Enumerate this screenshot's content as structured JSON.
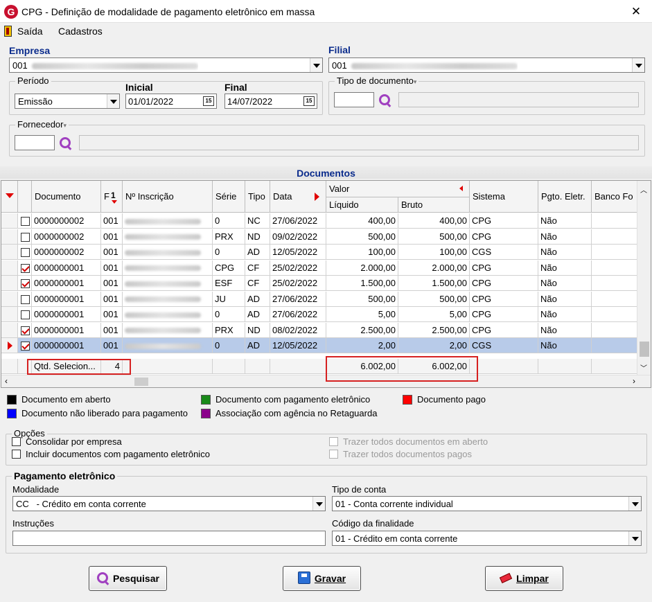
{
  "window": {
    "title": "CPG - Definição de modalidade de pagamento eletrônico em massa",
    "app_icon": "G",
    "close_symbol": "✕"
  },
  "menu": [
    {
      "label": "Saída"
    },
    {
      "label": "Cadastros"
    }
  ],
  "empresa": {
    "label": "Empresa",
    "value_prefix": "001"
  },
  "filial": {
    "label": "Filial",
    "value_prefix": "001"
  },
  "periodo": {
    "label": "Período",
    "value": "Emissão"
  },
  "inicial": {
    "label": "Inicial",
    "value": "01/01/2022"
  },
  "final": {
    "label": "Final",
    "value": "14/07/2022"
  },
  "calendar_icon_text": "15",
  "tipo_documento": {
    "label": "Tipo de documento"
  },
  "fornecedor": {
    "label": "Fornecedor"
  },
  "grid": {
    "title": "Documentos",
    "headers": {
      "documento": "Documento",
      "f": "F",
      "sort_num": "1",
      "inscricao": "Nº Inscrição",
      "serie": "Série",
      "tipo": "Tipo",
      "data": "Data",
      "valor": "Valor",
      "liquido": "Líquido",
      "bruto": "Bruto",
      "sistema": "Sistema",
      "pgto": "Pgto. Eletr.",
      "banco": "Banco Fo"
    },
    "rows": [
      {
        "checked": false,
        "documento": "0000000002",
        "f": "001",
        "serie": "0",
        "tipo": "NC",
        "data": "27/06/2022",
        "liquido": "400,00",
        "bruto": "400,00",
        "sistema": "CPG",
        "pgto": "Não",
        "selected": false
      },
      {
        "checked": false,
        "documento": "0000000002",
        "f": "001",
        "serie": "PRX",
        "tipo": "ND",
        "data": "09/02/2022",
        "liquido": "500,00",
        "bruto": "500,00",
        "sistema": "CPG",
        "pgto": "Não",
        "selected": false
      },
      {
        "checked": false,
        "documento": "0000000002",
        "f": "001",
        "serie": "0",
        "tipo": "AD",
        "data": "12/05/2022",
        "liquido": "100,00",
        "bruto": "100,00",
        "sistema": "CGS",
        "pgto": "Não",
        "selected": false
      },
      {
        "checked": true,
        "documento": "0000000001",
        "f": "001",
        "serie": "CPG",
        "tipo": "CF",
        "data": "25/02/2022",
        "liquido": "2.000,00",
        "bruto": "2.000,00",
        "sistema": "CPG",
        "pgto": "Não",
        "selected": false
      },
      {
        "checked": true,
        "documento": "0000000001",
        "f": "001",
        "serie": "ESF",
        "tipo": "CF",
        "data": "25/02/2022",
        "liquido": "1.500,00",
        "bruto": "1.500,00",
        "sistema": "CPG",
        "pgto": "Não",
        "selected": false
      },
      {
        "checked": false,
        "documento": "0000000001",
        "f": "001",
        "serie": "JU",
        "tipo": "AD",
        "data": "27/06/2022",
        "liquido": "500,00",
        "bruto": "500,00",
        "sistema": "CPG",
        "pgto": "Não",
        "selected": false
      },
      {
        "checked": false,
        "documento": "0000000001",
        "f": "001",
        "serie": "0",
        "tipo": "AD",
        "data": "27/06/2022",
        "liquido": "5,00",
        "bruto": "5,00",
        "sistema": "CPG",
        "pgto": "Não",
        "selected": false
      },
      {
        "checked": true,
        "documento": "0000000001",
        "f": "001",
        "serie": "PRX",
        "tipo": "ND",
        "data": "08/02/2022",
        "liquido": "2.500,00",
        "bruto": "2.500,00",
        "sistema": "CPG",
        "pgto": "Não",
        "selected": false
      },
      {
        "checked": true,
        "documento": "0000000001",
        "f": "001",
        "serie": "0",
        "tipo": "AD",
        "data": "12/05/2022",
        "liquido": "2,00",
        "bruto": "2,00",
        "sistema": "CGS",
        "pgto": "Não",
        "selected": true
      }
    ],
    "footer": {
      "qtd_label": "Qtd. Selecion...",
      "qtd_value": "4",
      "liquido_total": "6.002,00",
      "bruto_total": "6.002,00"
    }
  },
  "legend": [
    {
      "color": "#000000",
      "label": "Documento em aberto"
    },
    {
      "color": "#1a8a1a",
      "label": "Documento com pagamento eletrônico"
    },
    {
      "color": "#ff0000",
      "label": "Documento pago"
    },
    {
      "color": "#0000ff",
      "label": "Documento não liberado para pagamento"
    },
    {
      "color": "#8b008b",
      "label": "Associação com agência no Retaguarda"
    }
  ],
  "opcoes": {
    "title": "Opções",
    "consolidar": "Consolidar por empresa",
    "incluir": "Incluir documentos com pagamento eletrônico",
    "trazer_aberto": "Trazer todos documentos em aberto",
    "trazer_pagos": "Trazer todos documentos pagos"
  },
  "pagamento": {
    "title": "Pagamento eletrônico",
    "modalidade_label": "Modalidade",
    "modalidade_value": "CC   - Crédito em conta corrente",
    "tipo_conta_label": "Tipo de conta",
    "tipo_conta_value": "01 - Conta corrente individual",
    "instrucoes_label": "Instruções",
    "finalidade_label": "Código da finalidade",
    "finalidade_value": "01 - Crédito em conta corrente"
  },
  "buttons": {
    "pesquisar": "Pesquisar",
    "gravar": "Gravar",
    "limpar": "Limpar"
  }
}
